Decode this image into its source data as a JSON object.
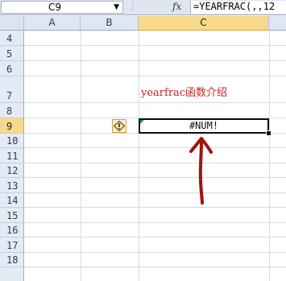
{
  "formula_bar": {
    "name_box": "C9",
    "dropdown_glyph": "▼",
    "separator": "⋮",
    "fx_label": "fx",
    "formula": "=YEARFRAC(,,12"
  },
  "columns": [
    "A",
    "B",
    "C"
  ],
  "rows": [
    "4",
    "5",
    "6",
    "7",
    "8",
    "9",
    "10",
    "11",
    "12",
    "13",
    "14",
    "15",
    "16",
    "17",
    "18"
  ],
  "active_cell": {
    "column": "C",
    "row": "9"
  },
  "cells": {
    "C7": "yearfrac函数介绍",
    "C9": "#NUM!"
  },
  "icons": {
    "error_indicator": "warning-diamond-icon",
    "annotation": "red-arrow-up-icon"
  },
  "colors": {
    "c7_text": "#c0261f",
    "active_header": "#f6d98a",
    "arrow": "#a0140f"
  }
}
